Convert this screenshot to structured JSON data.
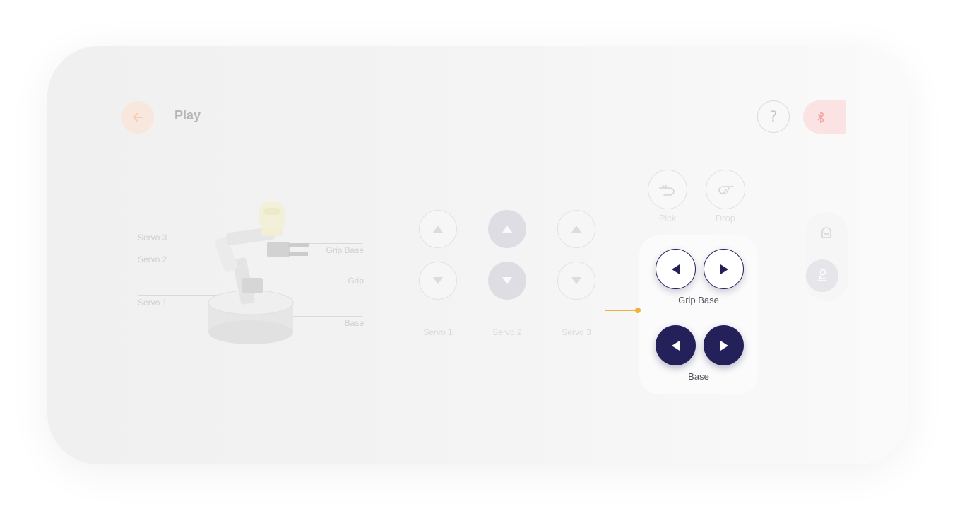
{
  "header": {
    "title": "Play",
    "back_icon": "arrow-left-icon",
    "help_label": "?",
    "bluetooth_icon": "bluetooth-icon"
  },
  "robot": {
    "labels": {
      "servo3": "Servo 3",
      "servo2": "Servo 2",
      "servo1": "Servo 1",
      "grip_base": "Grip Base",
      "grip": "Grip",
      "base": "Base"
    }
  },
  "servo_controls": {
    "columns": [
      {
        "label": "Servo 1",
        "style": "outline"
      },
      {
        "label": "Servo 2",
        "style": "filled"
      },
      {
        "label": "Servo 3",
        "style": "outline"
      }
    ]
  },
  "gripper_actions": {
    "pick_label": "Pick",
    "drop_label": "Drop"
  },
  "panel": {
    "grip_base_label": "Grip Base",
    "base_label": "Base"
  },
  "side": {
    "top_icon": "gripper-icon",
    "bottom_icon": "robot-arm-icon"
  },
  "colors": {
    "navy": "#24205a",
    "accent_orange": "#f2b13a",
    "back_bg": "#f7e7dc",
    "bluetooth_bg": "#fbe3e3"
  }
}
